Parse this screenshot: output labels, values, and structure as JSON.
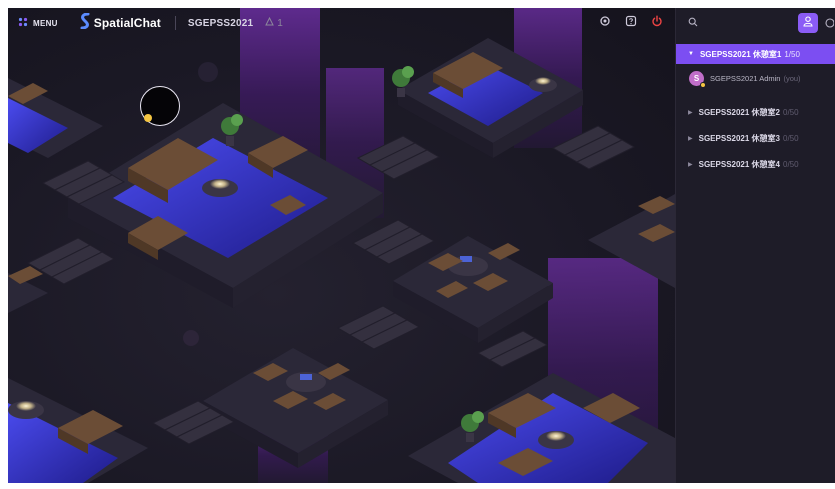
{
  "topbar": {
    "menu_label": "MENU",
    "brand_name": "SpatialChat",
    "space_name": "SGEPSS2021",
    "user_count": "1"
  },
  "sidebar": {
    "rooms": [
      {
        "name": "SGEPSS2021 休憩室1",
        "count": "1/50",
        "active": true
      },
      {
        "name": "SGEPSS2021 休憩室2",
        "count": "0/50",
        "active": false
      },
      {
        "name": "SGEPSS2021 休憩室3",
        "count": "0/50",
        "active": false
      },
      {
        "name": "SGEPSS2021 休憩室4",
        "count": "0/50",
        "active": false
      }
    ],
    "member": {
      "initial": "S",
      "name": "SGEPSS2021 Admin",
      "tag": "(you)"
    }
  },
  "colors": {
    "accent": "#7c4ef2",
    "background": "#16141f",
    "sidebar_bg": "#1e1c28",
    "water_blue": "#3d3fe0",
    "avatar": "#c06ec8",
    "logout": "#ef4444"
  },
  "icons": {
    "menu": "menu-grid-icon",
    "brand": "spatialchat-logo-icon",
    "users": "person-outline-icon",
    "settings": "gear-icon",
    "help": "question-icon",
    "logout": "power-icon",
    "search": "search-icon",
    "people": "people-icon"
  }
}
